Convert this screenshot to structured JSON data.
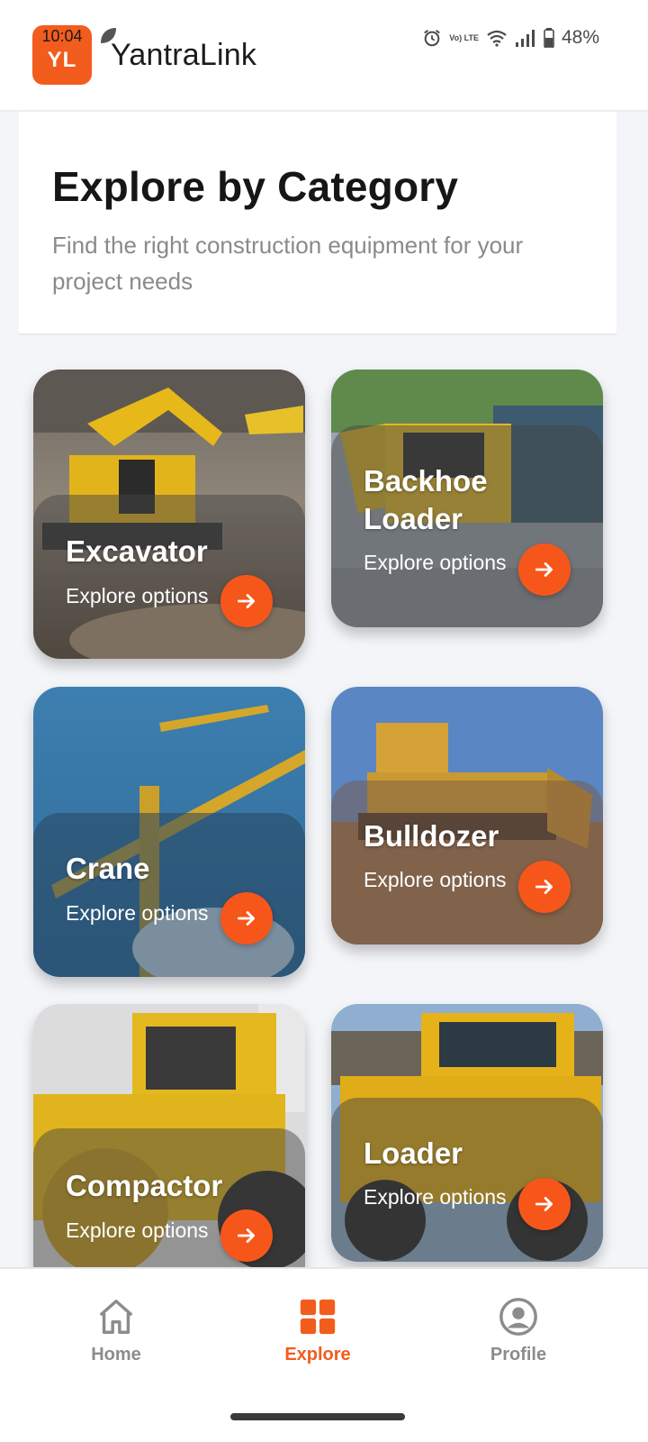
{
  "app": {
    "title": "YantraLink",
    "badge_initials": "YL",
    "brand_color": "#f25c1d"
  },
  "status_bar": {
    "time": "10:04",
    "battery": "48%",
    "network_label": "Vo) LTE",
    "icons": [
      "alarm-icon",
      "volte-icon",
      "wifi-icon",
      "signal-icon",
      "battery-icon"
    ]
  },
  "intro": {
    "title": "Explore by Category",
    "subtitle": "Find the right construction equipment for your project needs"
  },
  "categories": [
    {
      "title": "Excavator",
      "subtitle": "Explore options"
    },
    {
      "title": "Backhoe Loader",
      "subtitle": "Explore options"
    },
    {
      "title": "Crane",
      "subtitle": "Explore options"
    },
    {
      "title": "Bulldozer",
      "subtitle": "Explore options"
    },
    {
      "title": "Compactor",
      "subtitle": "Explore options"
    },
    {
      "title": "Loader",
      "subtitle": "Explore options"
    }
  ],
  "nav": {
    "items": [
      {
        "label": "Home",
        "icon": "home-icon",
        "active": false
      },
      {
        "label": "Explore",
        "icon": "grid-icon",
        "active": true
      },
      {
        "label": "Profile",
        "icon": "profile-icon",
        "active": false
      }
    ]
  }
}
